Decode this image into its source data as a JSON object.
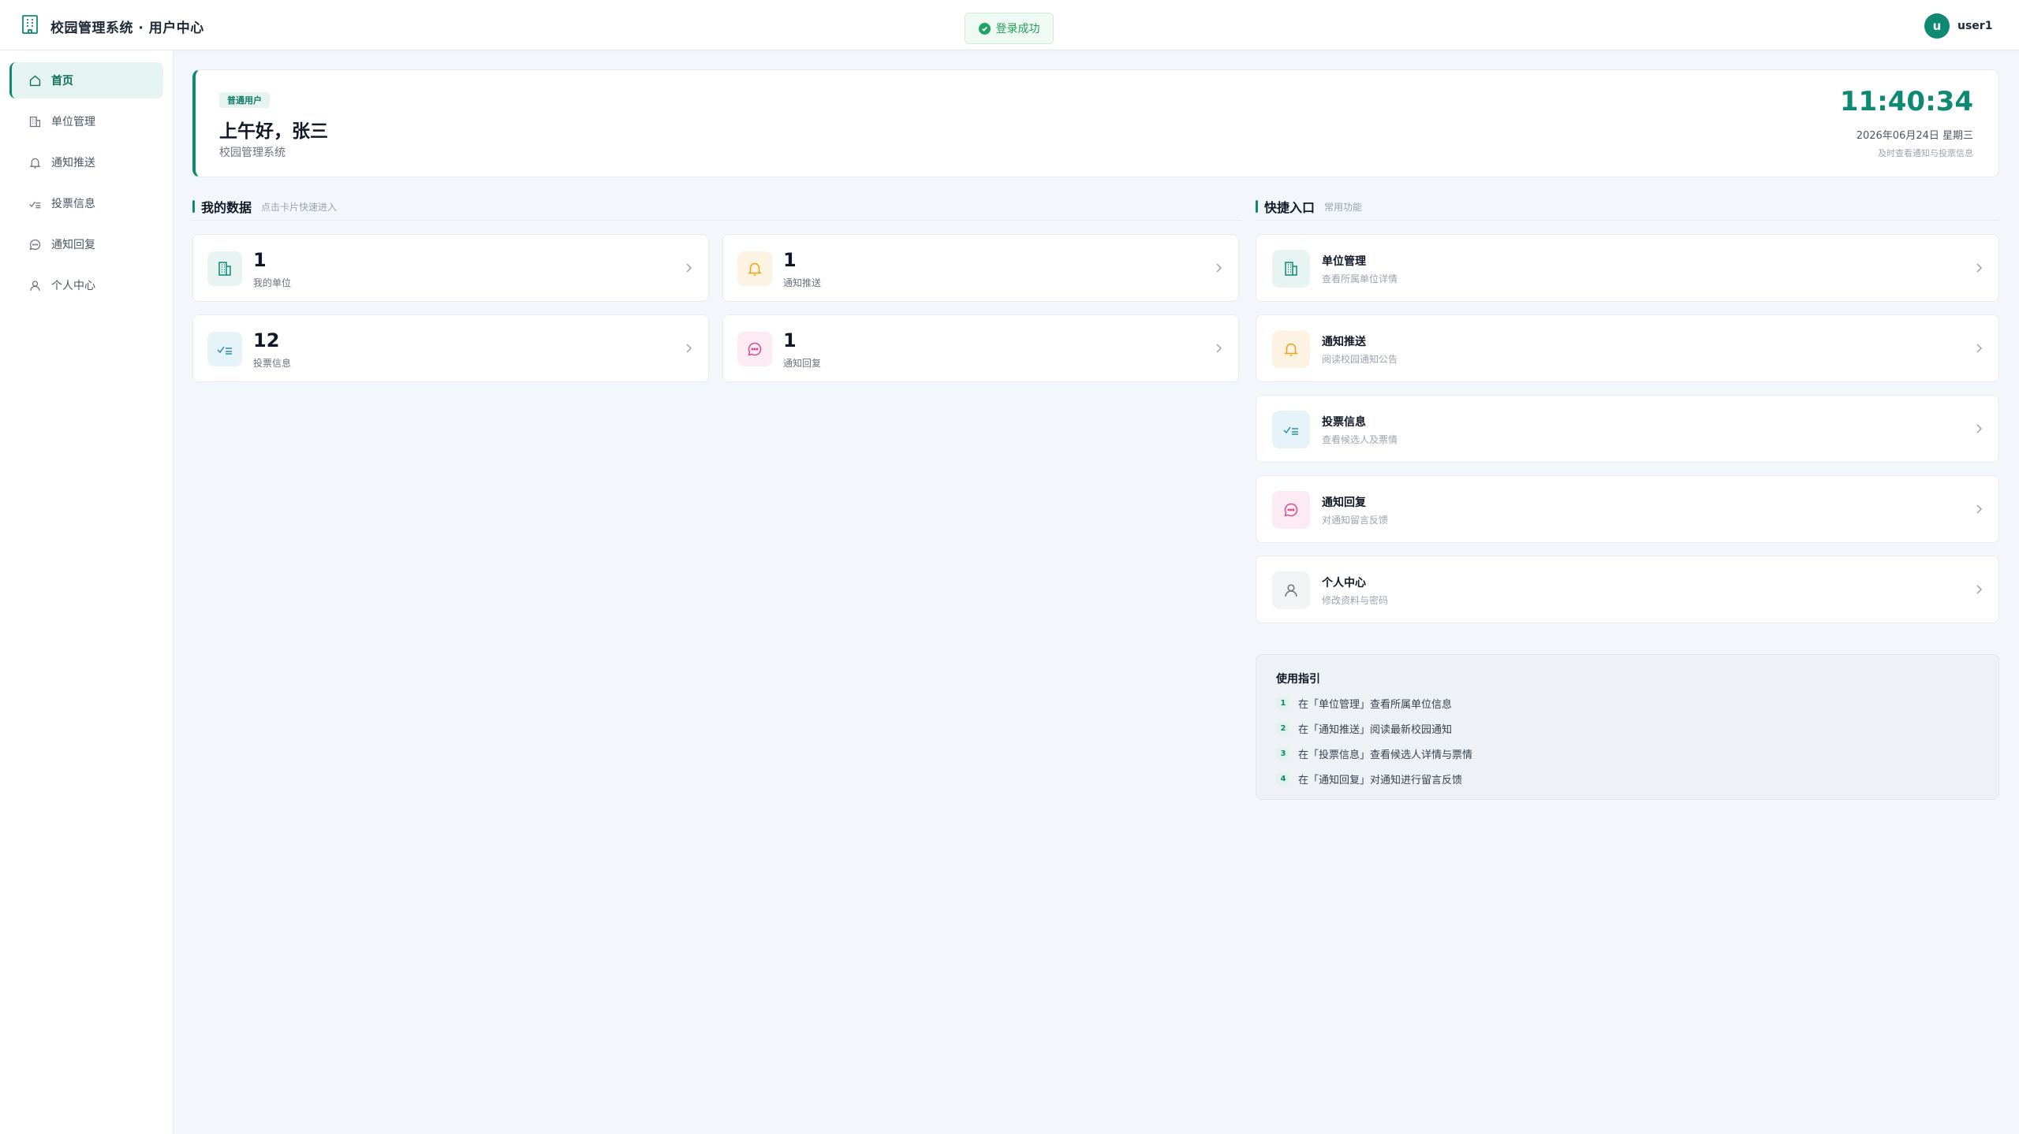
{
  "app": {
    "title": "校园管理系统 · 用户中心",
    "logo_icon": "building-icon"
  },
  "toast": {
    "text": "登录成功",
    "icon": "check-circle-icon"
  },
  "user": {
    "avatar_letter": "u",
    "name": "user1"
  },
  "sidebar": {
    "items": [
      {
        "label": "首页",
        "icon": "home-icon",
        "active": true
      },
      {
        "label": "单位管理",
        "icon": "building-icon"
      },
      {
        "label": "通知推送",
        "icon": "bell-icon"
      },
      {
        "label": "投票信息",
        "icon": "vote-icon"
      },
      {
        "label": "通知回复",
        "icon": "message-icon"
      },
      {
        "label": "个人中心",
        "icon": "user-icon"
      }
    ]
  },
  "welcome": {
    "role_badge": "普通用户",
    "greeting": "上午好，张三",
    "system_name": "校园管理系统",
    "clock": "11:40:34",
    "date": "2026年06月24日 星期三",
    "tip": "及时查看通知与投票信息"
  },
  "my_data": {
    "title": "我的数据",
    "subtitle": "点击卡片快速进入",
    "cards": [
      {
        "value": "1",
        "label": "我的单位",
        "icon": "building-icon"
      },
      {
        "value": "1",
        "label": "通知推送",
        "icon": "bell-icon"
      },
      {
        "value": "12",
        "label": "投票信息",
        "icon": "vote-icon"
      },
      {
        "value": "1",
        "label": "通知回复",
        "icon": "message-icon"
      }
    ]
  },
  "quick": {
    "title": "快捷入口",
    "subtitle": "常用功能",
    "items": [
      {
        "title": "单位管理",
        "desc": "查看所属单位详情",
        "icon": "building-icon"
      },
      {
        "title": "通知推送",
        "desc": "阅读校园通知公告",
        "icon": "bell-icon"
      },
      {
        "title": "投票信息",
        "desc": "查看候选人及票情",
        "icon": "vote-icon"
      },
      {
        "title": "通知回复",
        "desc": "对通知留言反馈",
        "icon": "message-icon"
      },
      {
        "title": "个人中心",
        "desc": "修改资料与密码",
        "icon": "user-icon"
      }
    ]
  },
  "guide": {
    "title": "使用指引",
    "steps": [
      {
        "n": "1",
        "text": "在「单位管理」查看所属单位信息"
      },
      {
        "n": "2",
        "text": "在「通知推送」阅读最新校园通知"
      },
      {
        "n": "3",
        "text": "在「投票信息」查看候选人详情与票情"
      },
      {
        "n": "4",
        "text": "在「通知回复」对通知进行留言反馈"
      }
    ]
  },
  "colors": {
    "accent": "#0e8a73",
    "orange": "#e8a317",
    "blue": "#2a8db0",
    "pink": "#d64d8f",
    "gray": "#6b7280",
    "success": "#20a464"
  }
}
